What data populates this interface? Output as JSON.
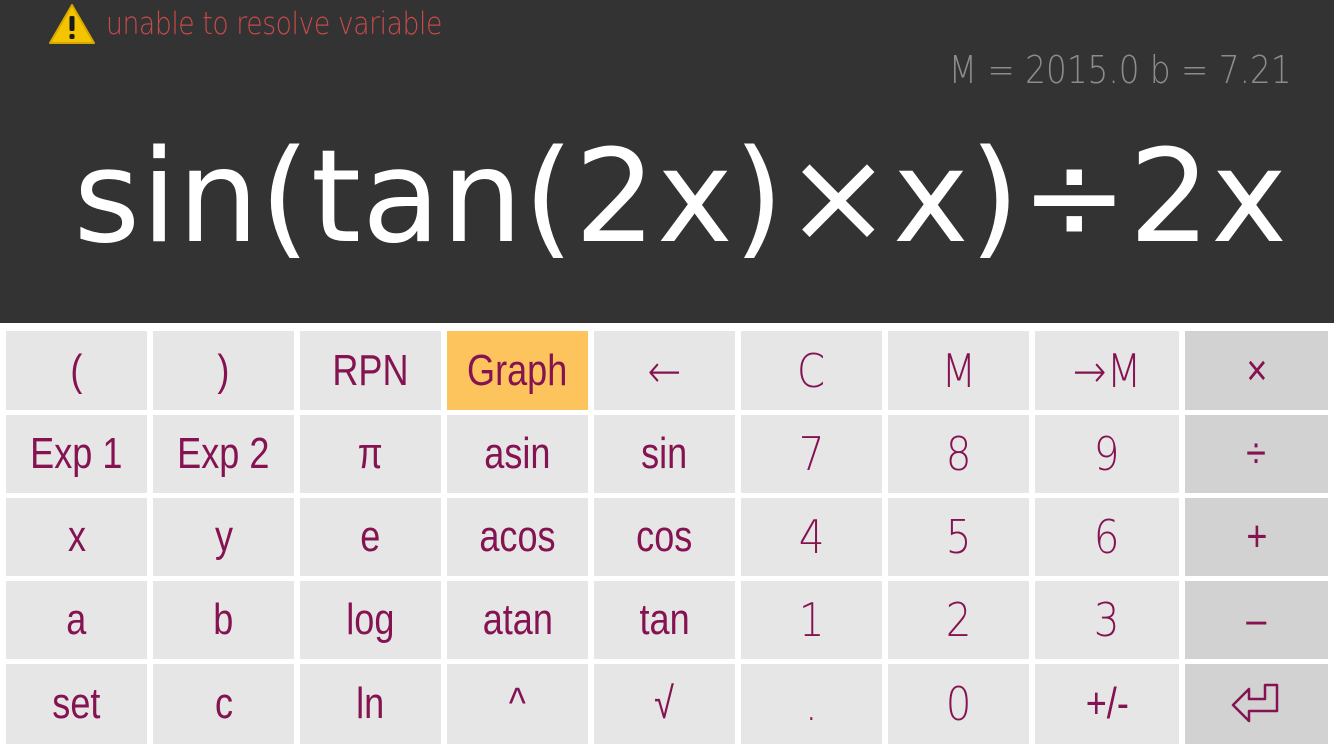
{
  "display": {
    "warning": {
      "icon": "warning-triangle-icon",
      "text": "unable to resolve variable"
    },
    "memory_line": "M =  2015.0 b =  7.21",
    "expression": "sin(tan(2x)×x)÷2x"
  },
  "keypad": {
    "rows": [
      [
        {
          "name": "open-paren",
          "label": "("
        },
        {
          "name": "close-paren",
          "label": ")"
        },
        {
          "name": "rpn",
          "label": "RPN"
        },
        {
          "name": "graph",
          "label": "Graph",
          "active": true
        },
        {
          "name": "backspace",
          "label": "←",
          "thin": true
        },
        {
          "name": "clear",
          "label": "C",
          "thin": true
        },
        {
          "name": "memory-recall",
          "label": "M",
          "thin": true
        },
        {
          "name": "memory-store",
          "label": "→M",
          "thin": true
        },
        {
          "name": "multiply",
          "label": "×",
          "op": true
        }
      ],
      [
        {
          "name": "exp-1",
          "label": "Exp 1"
        },
        {
          "name": "exp-2",
          "label": "Exp 2"
        },
        {
          "name": "pi",
          "label": "π"
        },
        {
          "name": "asin",
          "label": "asin"
        },
        {
          "name": "sin",
          "label": "sin"
        },
        {
          "name": "digit-7",
          "label": "7",
          "thin": true
        },
        {
          "name": "digit-8",
          "label": "8",
          "thin": true
        },
        {
          "name": "digit-9",
          "label": "9",
          "thin": true
        },
        {
          "name": "divide",
          "label": "÷",
          "op": true
        }
      ],
      [
        {
          "name": "var-x",
          "label": "x"
        },
        {
          "name": "var-y",
          "label": "y"
        },
        {
          "name": "const-e",
          "label": "e"
        },
        {
          "name": "acos",
          "label": "acos"
        },
        {
          "name": "cos",
          "label": "cos"
        },
        {
          "name": "digit-4",
          "label": "4",
          "thin": true
        },
        {
          "name": "digit-5",
          "label": "5",
          "thin": true
        },
        {
          "name": "digit-6",
          "label": "6",
          "thin": true
        },
        {
          "name": "add",
          "label": "+",
          "op": true
        }
      ],
      [
        {
          "name": "var-a",
          "label": "a"
        },
        {
          "name": "var-b",
          "label": "b"
        },
        {
          "name": "log",
          "label": "log"
        },
        {
          "name": "atan",
          "label": "atan"
        },
        {
          "name": "tan",
          "label": "tan"
        },
        {
          "name": "digit-1",
          "label": "1",
          "thin": true
        },
        {
          "name": "digit-2",
          "label": "2",
          "thin": true
        },
        {
          "name": "digit-3",
          "label": "3",
          "thin": true
        },
        {
          "name": "subtract",
          "label": "–",
          "op": true
        }
      ],
      [
        {
          "name": "set",
          "label": "set"
        },
        {
          "name": "var-c",
          "label": "c"
        },
        {
          "name": "ln",
          "label": "ln"
        },
        {
          "name": "power",
          "label": "^"
        },
        {
          "name": "sqrt",
          "label": "√"
        },
        {
          "name": "decimal-point",
          "label": ".",
          "thin": true
        },
        {
          "name": "digit-0",
          "label": "0",
          "thin": true
        },
        {
          "name": "negate",
          "label": "+/-"
        },
        {
          "name": "enter",
          "label": "",
          "icon": "enter-return-icon",
          "op": true
        }
      ]
    ]
  },
  "colors": {
    "display_bg": "#333333",
    "expression_text": "#ffffff",
    "memory_text": "#8c8c8c",
    "warning_text": "#c84a4a",
    "warning_icon": "#f5c400",
    "key_bg": "#e6e6e6",
    "operator_key_bg": "#d2d2d2",
    "active_key_bg": "#fdc45d",
    "key_text": "#851352"
  }
}
